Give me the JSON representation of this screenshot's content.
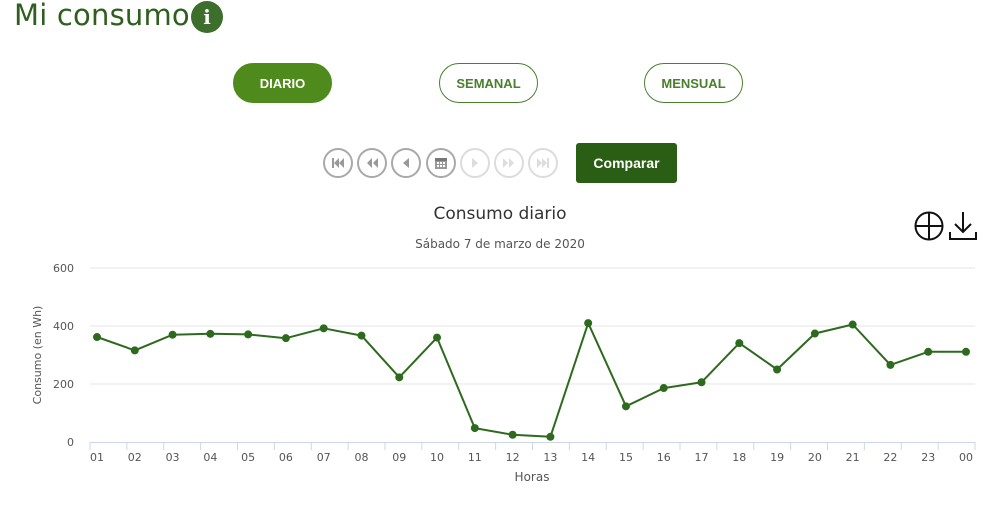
{
  "header": {
    "title": "Mi consumo",
    "info_icon_glyph": "i"
  },
  "periods": [
    {
      "label": "DIARIO",
      "active": true
    },
    {
      "label": "SEMANAL",
      "active": false
    },
    {
      "label": "MENSUAL",
      "active": false
    }
  ],
  "navigation": {
    "buttons": [
      {
        "icon": "first-icon",
        "enabled": true
      },
      {
        "icon": "rewind-icon",
        "enabled": true
      },
      {
        "icon": "previous-icon",
        "enabled": true
      },
      {
        "icon": "calendar-icon",
        "enabled": true
      },
      {
        "icon": "next-icon",
        "enabled": false
      },
      {
        "icon": "fast-forward-icon",
        "enabled": false
      },
      {
        "icon": "last-icon",
        "enabled": false
      }
    ],
    "compare_label": "Comparar"
  },
  "tools": [
    {
      "icon": "zoom-in-icon"
    },
    {
      "icon": "download-icon"
    }
  ],
  "colors": {
    "brand_dark": "#2b5e15",
    "brand": "#4f8a1c",
    "series": "#2d6a1e"
  },
  "chart_data": {
    "type": "line",
    "title": "Consumo diario",
    "subtitle": "Sábado 7 de marzo de 2020",
    "xlabel": "Horas",
    "ylabel": "Consumo (en Wh)",
    "ylim": [
      0,
      600
    ],
    "yticks": [
      0,
      200,
      400,
      600
    ],
    "grid": true,
    "categories": [
      "01",
      "02",
      "03",
      "04",
      "05",
      "06",
      "07",
      "08",
      "09",
      "10",
      "11",
      "12",
      "13",
      "14",
      "15",
      "16",
      "17",
      "18",
      "19",
      "20",
      "21",
      "22",
      "23",
      "00"
    ],
    "series": [
      {
        "values": [
          362,
          316,
          370,
          373,
          371,
          358,
          392,
          367,
          223,
          360,
          48,
          25,
          18,
          410,
          123,
          186,
          206,
          341,
          250,
          374,
          405,
          266,
          311,
          311
        ]
      }
    ]
  }
}
